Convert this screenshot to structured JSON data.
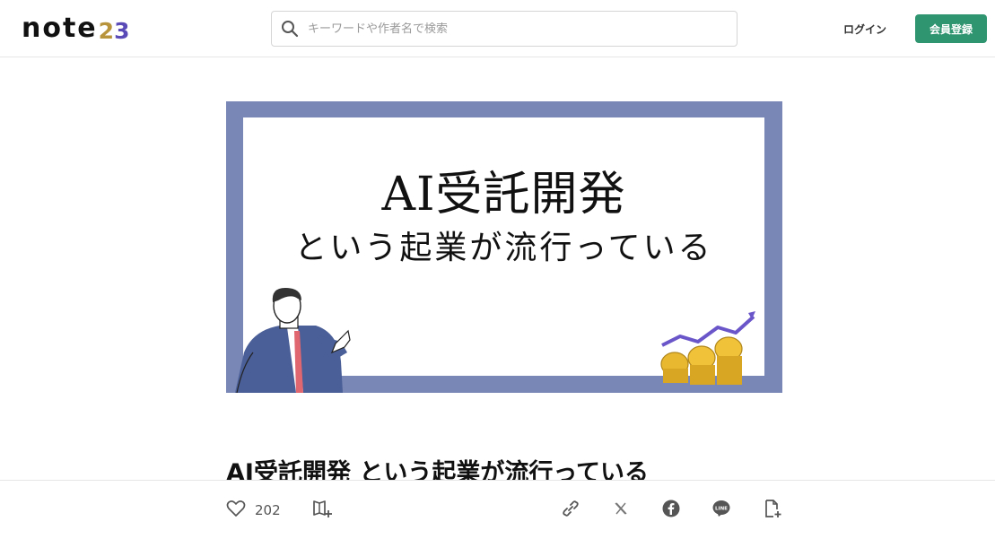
{
  "header": {
    "logo_text": "note",
    "logo_year_a": "2",
    "logo_year_b": "3",
    "search_placeholder": "キーワードや作者名で検索",
    "login_label": "ログイン",
    "signup_label": "会員登録",
    "signup_color": "#2f9470"
  },
  "hero": {
    "line1": "AI受託開発",
    "line2": "という起業が流行っている",
    "frame_color": "#7887b5"
  },
  "article": {
    "title": "AI受託開発 という起業が流行っている"
  },
  "actions": {
    "like_count": "202",
    "icons": [
      "heart-icon",
      "magazine-add-icon",
      "link-icon",
      "x-icon",
      "facebook-icon",
      "line-icon",
      "note-add-icon"
    ]
  }
}
